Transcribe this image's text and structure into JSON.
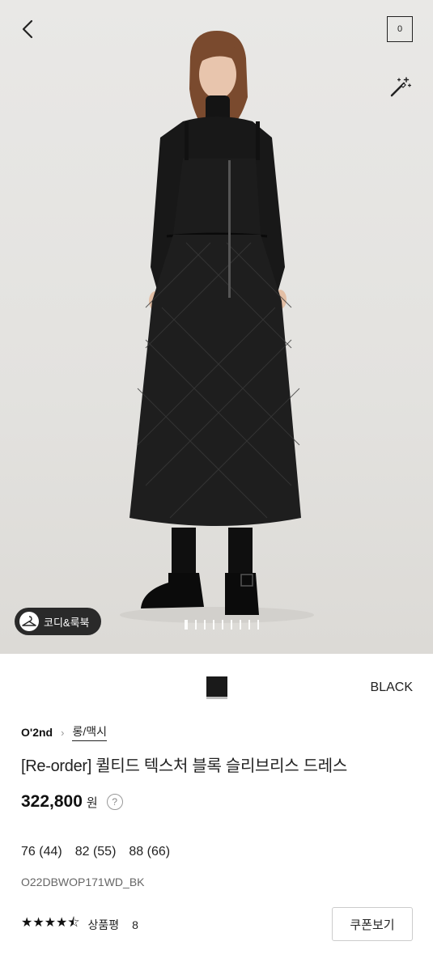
{
  "header": {
    "cart_count": "0",
    "back_icon": "chevron-left-icon",
    "magic_icon": "magic-wand-icon"
  },
  "hero": {
    "coordi_label": "코디&룩북",
    "coordi_icon": "hanger-icon",
    "pagination": {
      "total": 9,
      "active_index": 0
    },
    "colors": {
      "background": "#e5e4e1",
      "garment": "#141414"
    }
  },
  "color_option": {
    "name": "BLACK",
    "swatch_color": "#1a1a1a"
  },
  "product": {
    "brand": "O'2nd",
    "category": "롱/맥시",
    "title": "[Re-order] 퀼티드 텍스처 블록 슬리브리스 드레스",
    "price": "322,800",
    "currency": "원",
    "help_label": "?",
    "sizes": [
      "76 (44)",
      "82 (55)",
      "88 (66)"
    ],
    "sku": "O22DBWOP171WD_BK",
    "rating": 4.5,
    "stars": "★★★★⯪",
    "review_label": "상품평",
    "review_count": "8",
    "coupon_label": "쿠폰보기"
  }
}
